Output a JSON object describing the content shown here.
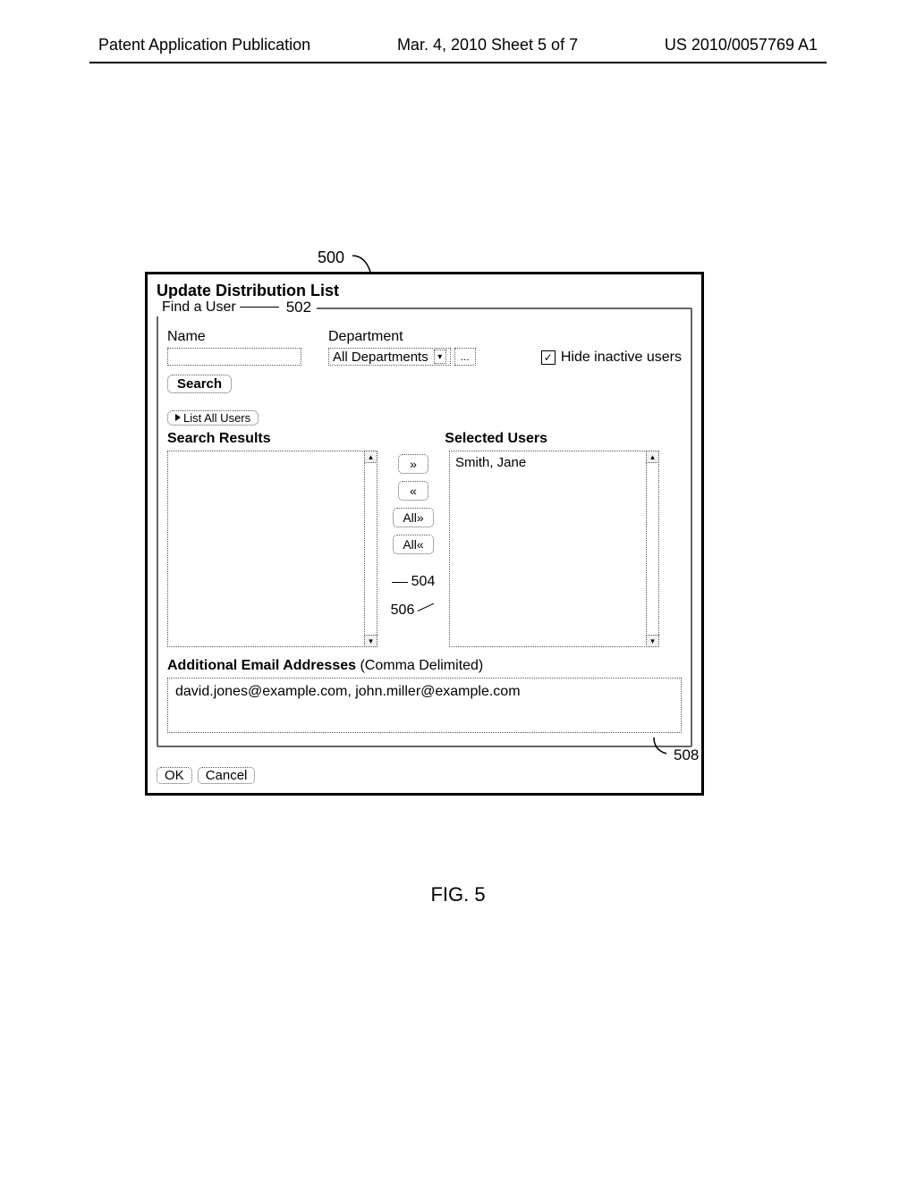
{
  "header": {
    "left": "Patent Application Publication",
    "center": "Mar. 4, 2010  Sheet 5 of 7",
    "right": "US 2010/0057769 A1"
  },
  "refs": {
    "r500": "500",
    "r502": "502",
    "r504": "504",
    "r506": "506",
    "r508": "508"
  },
  "dialog": {
    "title": "Update Distribution List",
    "find_legend": "Find a User",
    "name_label": "Name",
    "name_value": "",
    "department_label": "Department",
    "department_value": "All Departments",
    "department_more": "...",
    "hide_inactive_label": "Hide inactive users",
    "hide_inactive_checked": true,
    "search_label": "Search",
    "list_all_label": "List All Users",
    "search_results_label": "Search Results",
    "selected_users_label": "Selected Users",
    "search_results_items": [],
    "selected_users_items": [
      "Smith, Jane"
    ],
    "transfer": {
      "add": "»",
      "remove": "«",
      "add_all": "All»",
      "remove_all": "All«"
    },
    "additional_label_bold": "Additional Email Addresses",
    "additional_label_rest": " (Comma Delimited)",
    "additional_value": "david.jones@example.com, john.miller@example.com",
    "ok_label": "OK",
    "cancel_label": "Cancel"
  },
  "figure_caption": "FIG. 5"
}
